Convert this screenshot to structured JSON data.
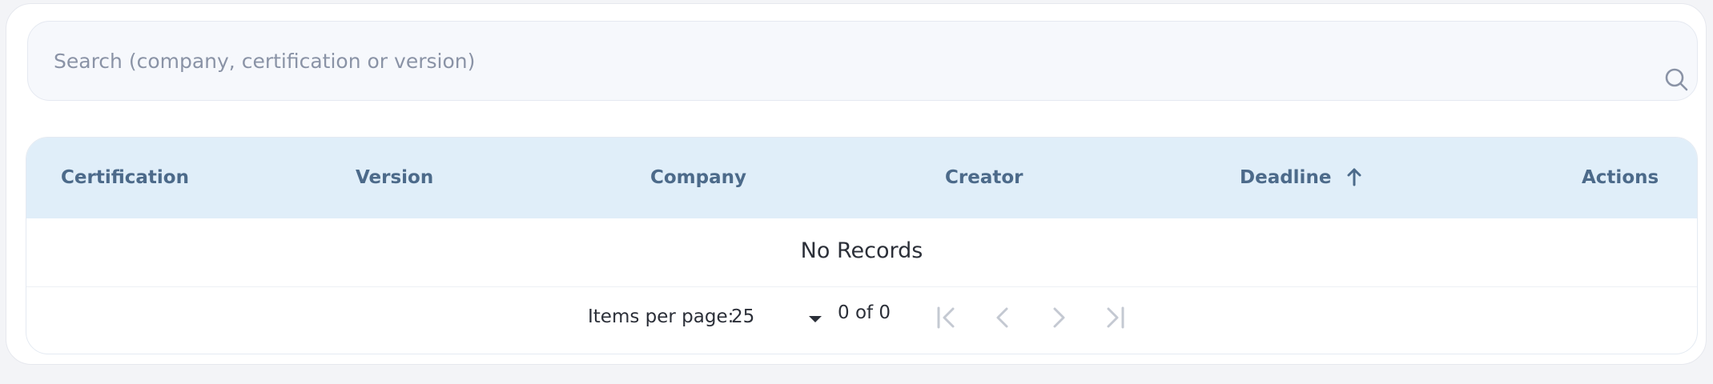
{
  "search": {
    "placeholder": "Search (company, certification or version)",
    "value": "",
    "icon": "search-icon"
  },
  "table": {
    "columns": [
      {
        "label": "Certification"
      },
      {
        "label": "Version"
      },
      {
        "label": "Company"
      },
      {
        "label": "Creator"
      },
      {
        "label": "Deadline",
        "sort": "ascending",
        "sort_icon": "arrow-up-icon"
      },
      {
        "label": "Actions"
      }
    ],
    "rows": [],
    "empty_message": "No Records"
  },
  "paginator": {
    "items_per_page_label": "Items per page:",
    "items_per_page_value": "25",
    "range_label": "0 of 0",
    "buttons": [
      "first-page-icon",
      "previous-page-icon",
      "next-page-icon",
      "last-page-icon"
    ]
  },
  "colors": {
    "header_background": "#e0eef9",
    "header_text": "#4c6a8a",
    "search_background": "#f6f8fc",
    "disabled_icon": "#c4c9d2"
  }
}
